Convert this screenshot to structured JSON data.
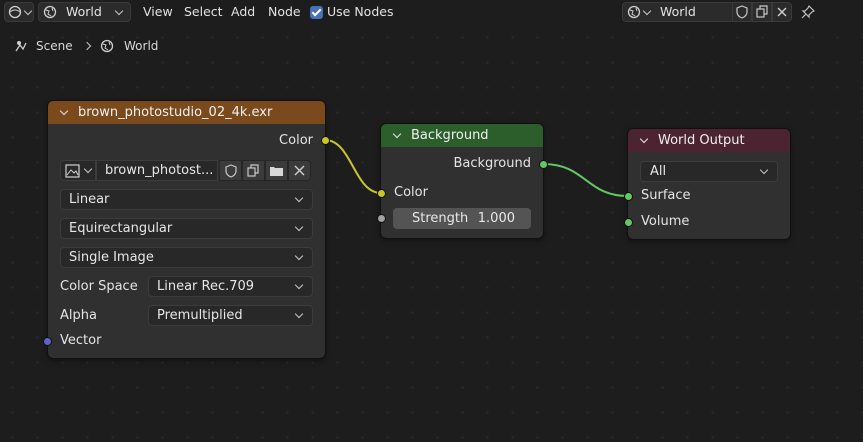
{
  "header": {
    "world_selector": "World",
    "menu": [
      "View",
      "Select",
      "Add",
      "Node"
    ],
    "use_nodes_label": "Use Nodes",
    "use_nodes_checked": true,
    "datablock_name": "World"
  },
  "breadcrumb": [
    "Scene",
    "World"
  ],
  "image_node": {
    "title": "brown_photostudio_02_4k.exr",
    "output": "Color",
    "image_name": "brown_photost...",
    "interpolation": "Linear",
    "projection": "Equirectangular",
    "source": "Single Image",
    "color_space_label": "Color Space",
    "color_space": "Linear Rec.709",
    "alpha_label": "Alpha",
    "alpha": "Premultiplied",
    "input": "Vector"
  },
  "background_node": {
    "title": "Background",
    "output": "Background",
    "input_color": "Color",
    "strength_label": "Strength",
    "strength_value": "1.000"
  },
  "output_node": {
    "title": "World Output",
    "target": "All",
    "input_surface": "Surface",
    "input_volume": "Volume"
  },
  "colors": {
    "image_header": "#7a4a1c",
    "background_header": "#2c5e2c",
    "output_header": "#4c2330",
    "color_socket": "#c7c729",
    "shader_socket": "#63c763",
    "vector_socket": "#6363c7",
    "float_socket": "#a1a1a1"
  }
}
